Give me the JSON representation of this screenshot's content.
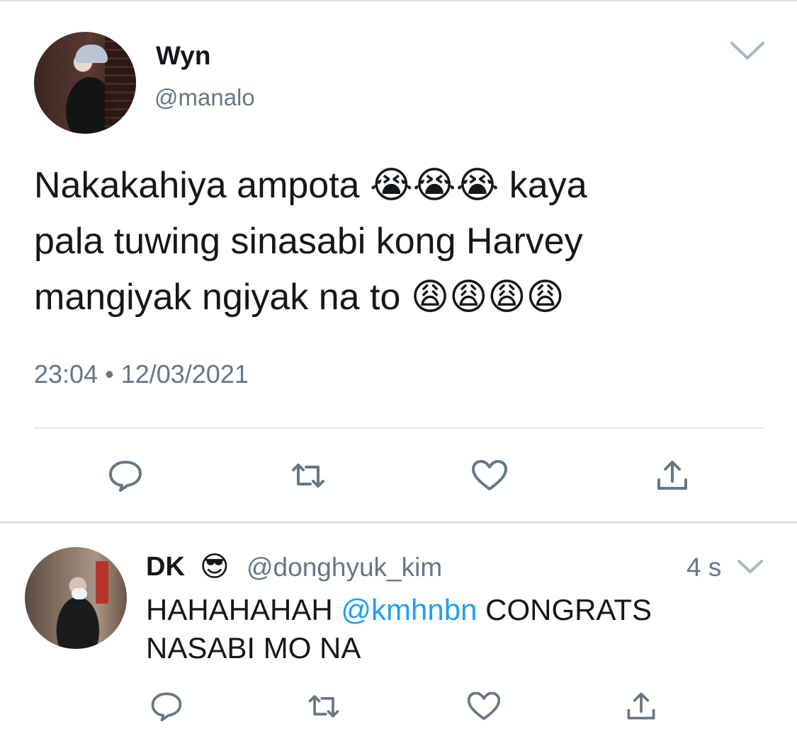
{
  "main_tweet": {
    "author_name": "Wyn",
    "author_handle": "@manalo",
    "text_line1_a": "Nakakahiya ampota ",
    "text_line1_emoji": "😭😭😭",
    "text_line1_b": " kaya",
    "text_line2": "pala tuwing sinasabi kong Harvey",
    "text_line3_a": "mangiyak ngiyak na to ",
    "text_line3_emoji": "😩😩😩😩",
    "timestamp": "23:04 • 12/03/2021",
    "actions": [
      "reply-icon",
      "retweet-icon",
      "like-icon",
      "share-icon"
    ]
  },
  "reply_tweet": {
    "author_name": "DK",
    "author_emoji": "😎",
    "author_handle": "@donghyuk_kim",
    "time_ago": "4 s",
    "text_a": "HAHAHAHAH ",
    "mention": "@kmhnbn",
    "text_b": " CONGRATS",
    "text_line2": "NASABI MO NA",
    "actions": [
      "reply-icon",
      "retweet-icon",
      "like-icon",
      "share-icon"
    ]
  },
  "colors": {
    "text": "#14171a",
    "secondary": "#657786",
    "mention": "#1da1f2",
    "icon": "#657786",
    "divider": "#e1e8ed"
  }
}
